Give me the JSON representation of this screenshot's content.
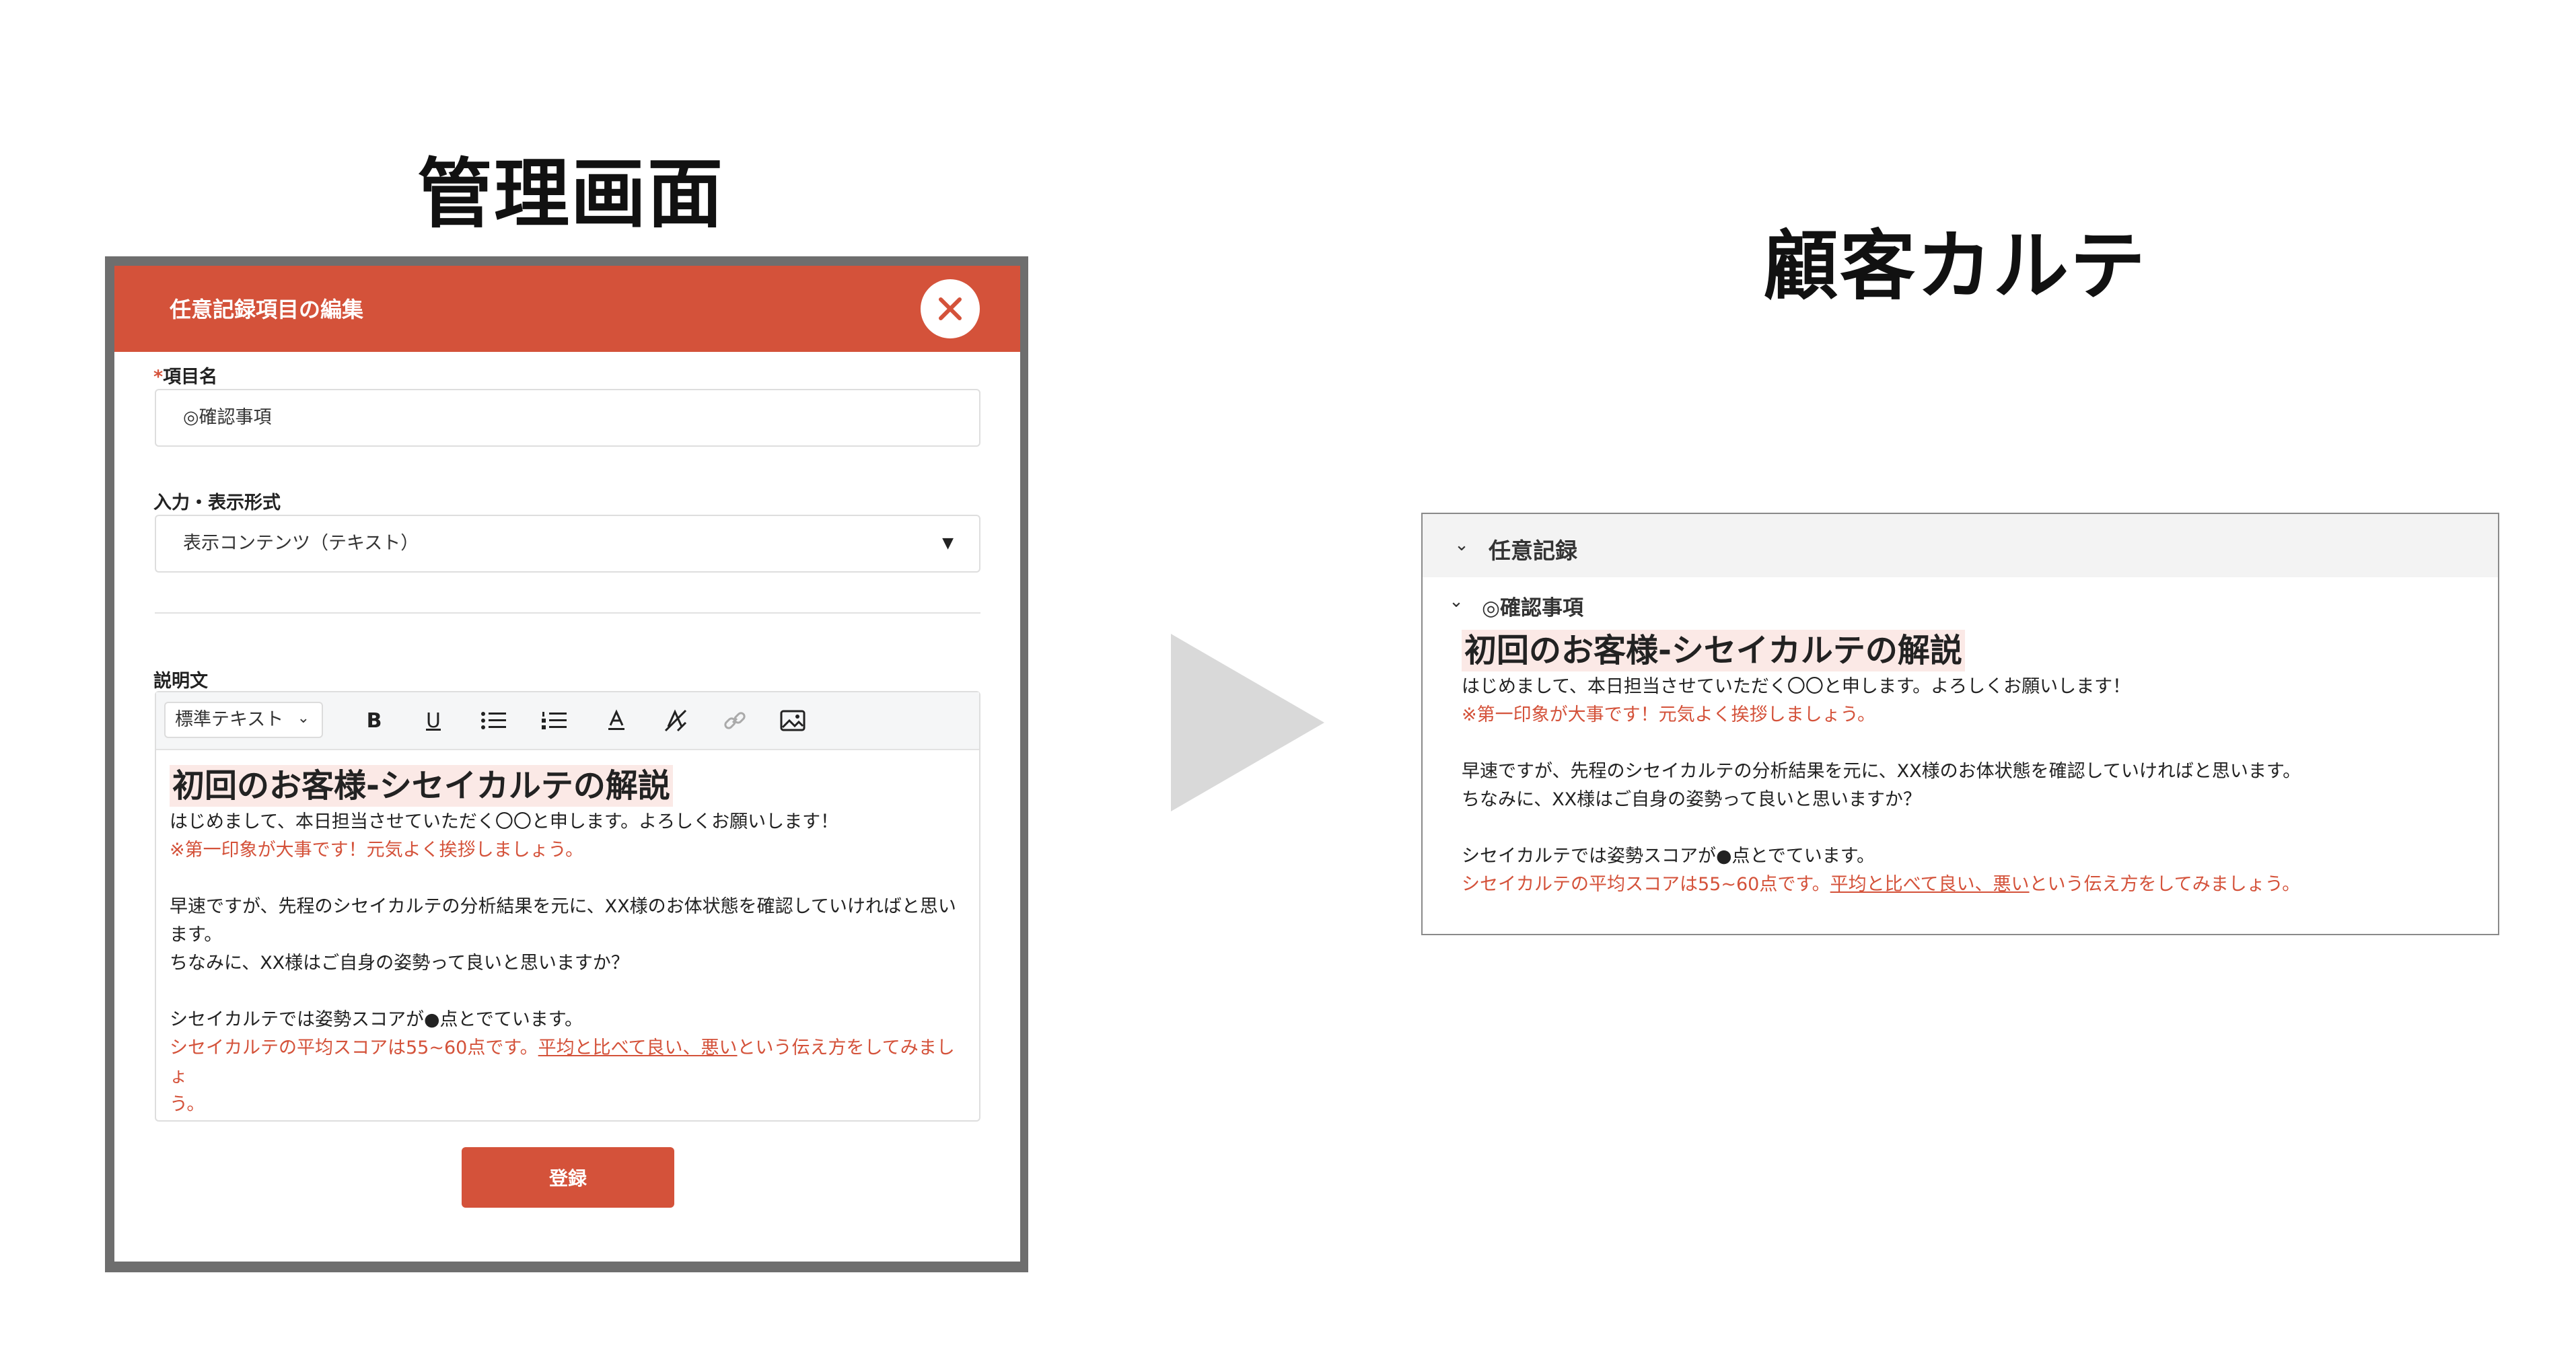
{
  "headings": {
    "admin": "管理画面",
    "customer_chart": "顧客カルテ"
  },
  "modal": {
    "title": "任意記録項目の編集",
    "close_icon": "close-icon",
    "item_name_label": "項目名",
    "required_mark": "*",
    "item_name_value": "◎確認事項",
    "format_label": "入力・表示形式",
    "format_value": "表示コンテンツ（テキスト）",
    "description_label": "説明文",
    "submit_label": "登録",
    "accent_color": "#d4523a"
  },
  "editor": {
    "style_select": "標準テキスト",
    "toolbar_icons": [
      "bold-icon",
      "underline-icon",
      "bullet-list-icon",
      "numbered-list-icon",
      "font-color-icon",
      "clear-format-icon",
      "link-icon",
      "image-icon"
    ],
    "heading": "初回のお客様-シセイカルテの解説",
    "line1": "はじめまして、本日担当させていただく〇〇と申します。よろしくお願いします！",
    "line2": "※第一印象が大事です！元気よく挨拶しましょう。",
    "line3a": "早速ですが、先程のシセイカルテの分析結果を元に、XX様のお体状態を確認していければと思い",
    "line3b": "ます。",
    "line4": "ちなみに、XX様はご自身の姿勢って良いと思いますか？",
    "line5": "シセイカルテでは姿勢スコアが●点とでています。",
    "line6_pre": "シセイカルテの平均スコアは55~60点です。",
    "line6_ul": "平均と比べて良い、悪い",
    "line6_post_a": "という伝え方をしてみましょ",
    "line6_post_b": "う。"
  },
  "customer_chart": {
    "section_title": "任意記録",
    "item_title": "◎確認事項",
    "heading": "初回のお客様-シセイカルテの解説",
    "line1": "はじめまして、本日担当させていただく〇〇と申します。よろしくお願いします！",
    "line2": "※第一印象が大事です！元気よく挨拶しましょう。",
    "line3": "早速ですが、先程のシセイカルテの分析結果を元に、XX様のお体状態を確認していければと思います。",
    "line4": "ちなみに、XX様はご自身の姿勢って良いと思いますか？",
    "line5": "シセイカルテでは姿勢スコアが●点とでています。",
    "line6_pre": "シセイカルテの平均スコアは55~60点です。",
    "line6_ul": "平均と比べて良い、悪い",
    "line6_post": "という伝え方をしてみましょう。"
  }
}
